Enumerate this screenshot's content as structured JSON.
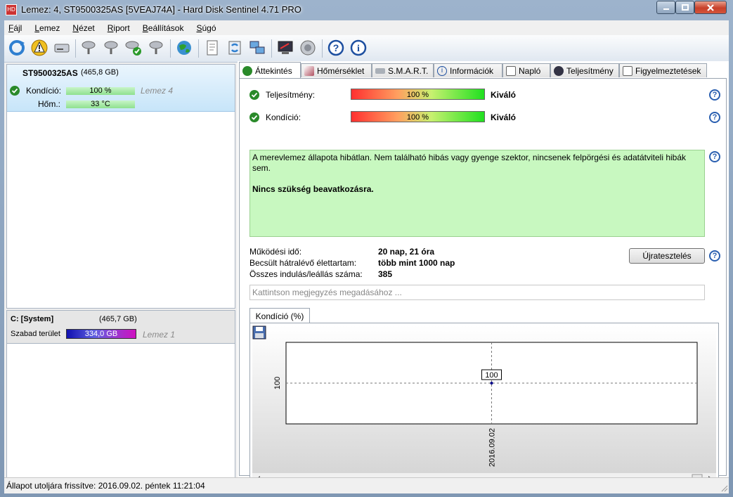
{
  "window": {
    "title": "Lemez: 4, ST9500325AS [5VEAJ74A]  -  Hard Disk Sentinel 4.71 PRO"
  },
  "menu": [
    "Fájl",
    "Lemez",
    "Nézet",
    "Riport",
    "Beállítások",
    "Súgó"
  ],
  "toolbar_icons": [
    "refresh-icon",
    "warning-icon",
    "drive-icon",
    "probe-icon",
    "probe-icon",
    "probe-ok-icon",
    "probe-icon",
    "globe-icon",
    "document-icon",
    "sync-icon",
    "network-icon",
    "monitor-icon",
    "speaker-icon",
    "help-icon",
    "info-icon"
  ],
  "left": {
    "disk_name": "ST9500325AS",
    "disk_size": "(465,8 GB)",
    "condition_label": "Kondíció:",
    "condition_value": "100 %",
    "condition_level": 1.0,
    "disk_ref": "Lemez 4",
    "temp_label": "Hőm.:",
    "temp_value": "33 °C",
    "partition_name": "C: [System]",
    "partition_size": "(465,7 GB)",
    "free_label": "Szabad terület",
    "free_value": "334,0 GB",
    "partition_disk_ref": "Lemez 1"
  },
  "tabs": [
    "Áttekintés",
    "Hőmérséklet",
    "S.M.A.R.T.",
    "Információk",
    "Napló",
    "Teljesítmény",
    "Figyelmeztetések"
  ],
  "overview": {
    "performance_label": "Teljesítmény:",
    "performance_value": "100 %",
    "performance_rating": "Kiváló",
    "condition_label": "Kondíció:",
    "condition_value": "100 %",
    "condition_rating": "Kiváló",
    "status_text": "A merevlemez állapota hibátlan. Nem található hibás vagy gyenge szektor, nincsenek felpörgési és adatátviteli hibák sem.",
    "status_action": "Nincs szükség beavatkozásra.",
    "uptime_label": "Működési idő:",
    "uptime_value": "20 nap, 21 óra",
    "remaining_label": "Becsült hátralévő élettartam:",
    "remaining_value": "több mint 1000 nap",
    "starts_label": "Összes indulás/leállás száma:",
    "starts_value": "385",
    "reset_button": "Újratesztelés",
    "note_placeholder": "Kattintson megjegyzés megadásához ...",
    "chart_tab": "Kondíció  (%)"
  },
  "chart_data": {
    "type": "line",
    "x": [
      "2016.09.02"
    ],
    "series": [
      {
        "values": [
          100
        ]
      }
    ],
    "y_tick_labels": [
      "100"
    ],
    "data_labels": [
      "100"
    ],
    "grid": true
  },
  "statusbar": {
    "text": "Állapot utoljára frissítve: 2016.09.02. péntek 11:21:04"
  },
  "colors": {
    "good_green": "#2a8a2a",
    "status_bg": "#c8f8c0",
    "free_bar": "#2020c0",
    "help_blue": "#2a5fb0"
  }
}
